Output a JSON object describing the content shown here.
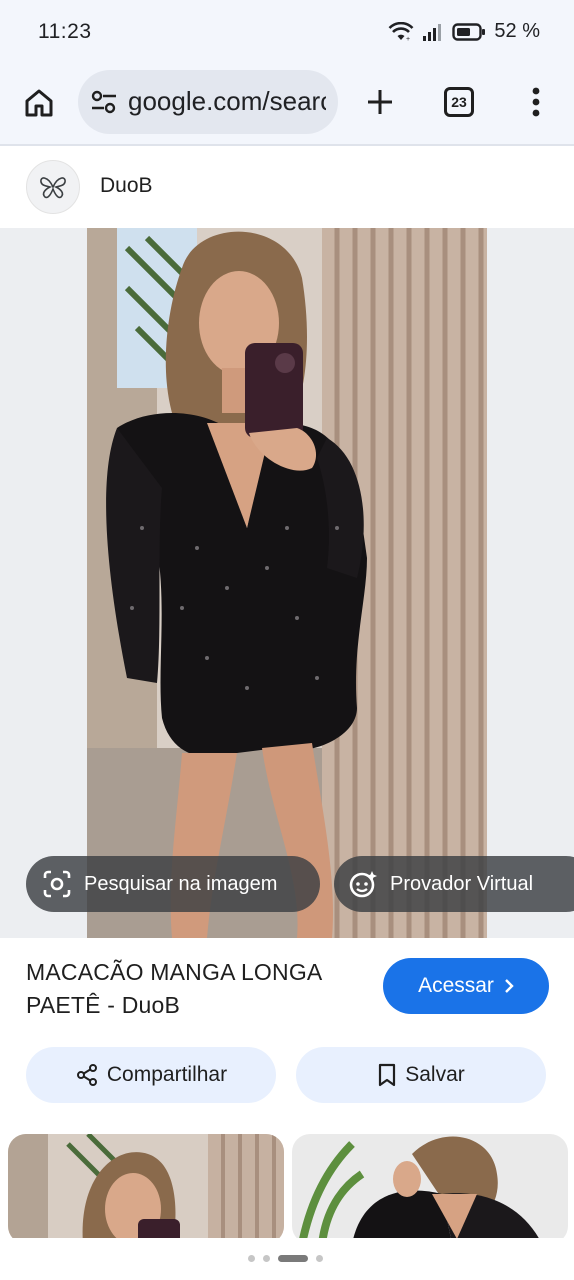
{
  "status_bar": {
    "time": "11:23",
    "battery_percent": "52 %",
    "icons": [
      "wifi-icon",
      "signal-icon",
      "battery-icon"
    ]
  },
  "browser": {
    "url": "google.com/search",
    "tab_count": "23",
    "icons": [
      "home-icon",
      "tune-icon",
      "plus-icon",
      "tabs-icon",
      "more-vert-icon"
    ]
  },
  "source": {
    "name": "DuoB",
    "icon": "butterfly-logo-icon"
  },
  "image_actions": {
    "search_in_image": "Pesquisar na imagem",
    "virtual_try_on": "Provador Virtual"
  },
  "result": {
    "title": "MACACÃO MANGA LONGA PAETÊ - DuoB",
    "visit_label": "Acessar"
  },
  "actions": {
    "share_label": "Compartilhar",
    "save_label": "Salvar"
  },
  "colors": {
    "accent": "#1a73e8",
    "chrome_bg": "#f3f6fc",
    "pill_bg": "#e8f0fe"
  }
}
